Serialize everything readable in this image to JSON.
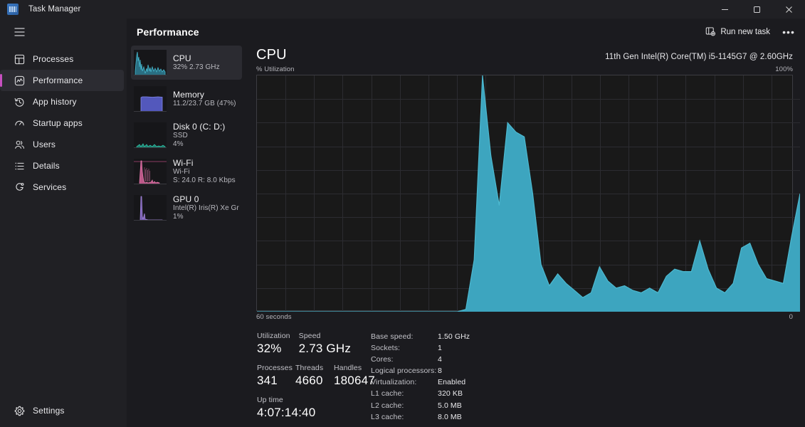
{
  "window": {
    "title": "Task Manager",
    "app_icon": "task-manager-icon",
    "minimize": "minimize-icon",
    "maximize": "maximize-icon",
    "close": "close-icon"
  },
  "sidebar": {
    "hamburger_label": "hamburger-icon",
    "items": [
      {
        "label": "Processes",
        "icon": "processes-icon",
        "selected": false
      },
      {
        "label": "Performance",
        "icon": "performance-icon",
        "selected": true
      },
      {
        "label": "App history",
        "icon": "history-icon",
        "selected": false
      },
      {
        "label": "Startup apps",
        "icon": "startup-icon",
        "selected": false
      },
      {
        "label": "Users",
        "icon": "users-icon",
        "selected": false
      },
      {
        "label": "Details",
        "icon": "details-icon",
        "selected": false
      },
      {
        "label": "Services",
        "icon": "services-icon",
        "selected": false
      }
    ],
    "settings": {
      "label": "Settings",
      "icon": "gear-icon"
    }
  },
  "toolbar": {
    "page_title": "Performance",
    "run_new_task": "Run new task",
    "run_new_task_icon": "new-task-icon",
    "more_label": "•••"
  },
  "devices": [
    {
      "name": "CPU",
      "line1": "32% 2.73 GHz",
      "line2": "",
      "selected": true,
      "color": "#3aa6bf"
    },
    {
      "name": "Memory",
      "line1": "11.2/23.7 GB (47%)",
      "line2": "",
      "selected": false,
      "color": "#6b6fd4"
    },
    {
      "name": "Disk 0 (C: D:)",
      "line1": "SSD",
      "line2": "4%",
      "selected": false,
      "color": "#2bb49a"
    },
    {
      "name": "Wi-Fi",
      "line1": "Wi-Fi",
      "line2": "S: 24.0 R: 8.0 Kbps",
      "selected": false,
      "color": "#d86ba6"
    },
    {
      "name": "GPU 0",
      "line1": "Intel(R) Iris(R) Xe Gra…",
      "line2": "1%",
      "selected": false,
      "color": "#9b78d8"
    }
  ],
  "graph": {
    "title": "CPU",
    "cpu_name": "11th Gen Intel(R) Core(TM) i5-1145G7 @ 2.60GHz",
    "y_axis_label": "% Utilization",
    "y_max_label": "100%",
    "x_left_label": "60 seconds",
    "x_right_label": "0"
  },
  "chart_data": {
    "type": "area",
    "title": "CPU % Utilization over 60 seconds",
    "xlabel": "60 seconds",
    "ylabel": "% Utilization",
    "ylim": [
      0,
      100
    ],
    "xlim": [
      0,
      60
    ],
    "grid": true,
    "legend": null,
    "series_color": "#3da5bf",
    "line_color": "#4cb9d0",
    "x": [
      0,
      1,
      2,
      3,
      4,
      5,
      6,
      7,
      8,
      9,
      10,
      11,
      12,
      13,
      14,
      15,
      16,
      17,
      18,
      19,
      20,
      21,
      22,
      23,
      24,
      25,
      26,
      27,
      28,
      29,
      30,
      31,
      32,
      33,
      34,
      35,
      36,
      37,
      38,
      39,
      40,
      41,
      42,
      43,
      44,
      45,
      46,
      47,
      48,
      49,
      50,
      51,
      52,
      53,
      54,
      55,
      56,
      57,
      58,
      59,
      60
    ],
    "values": [
      0,
      0,
      0,
      0,
      0,
      0,
      0,
      0,
      0,
      0,
      0,
      0,
      0,
      0,
      0,
      0,
      0,
      0,
      0,
      0,
      0,
      0,
      0,
      0,
      0,
      1,
      22,
      100,
      66,
      45,
      80,
      76,
      74,
      50,
      20,
      11,
      16,
      12,
      9,
      6,
      8,
      19,
      13,
      10,
      11,
      9,
      8,
      10,
      8,
      15,
      18,
      17,
      17,
      30,
      18,
      10,
      8,
      12,
      27,
      29,
      20,
      14,
      13,
      12,
      32,
      50
    ],
    "note": "Idle for first 25 intervals, spike to 100% then sustained activity tapering down with periodic bumps; final value rising to ~50%"
  },
  "stats": {
    "left": [
      [
        {
          "label": "Utilization",
          "value": "32%"
        },
        {
          "label": "Speed",
          "value": "2.73 GHz"
        }
      ],
      [
        {
          "label": "Processes",
          "value": "341"
        },
        {
          "label": "Threads",
          "value": "4660"
        },
        {
          "label": "Handles",
          "value": "180647"
        }
      ],
      [
        {
          "label": "Up time",
          "value": "4:07:14:40"
        }
      ]
    ],
    "right": [
      {
        "key": "Base speed:",
        "value": "1.50 GHz"
      },
      {
        "key": "Sockets:",
        "value": "1"
      },
      {
        "key": "Cores:",
        "value": "4"
      },
      {
        "key": "Logical processors:",
        "value": "8"
      },
      {
        "key": "Virtualization:",
        "value": "Enabled"
      },
      {
        "key": "L1 cache:",
        "value": "320 KB"
      },
      {
        "key": "L2 cache:",
        "value": "5.0 MB"
      },
      {
        "key": "L3 cache:",
        "value": "8.0 MB"
      }
    ]
  },
  "colors": {
    "accent_selection": "#c750c0",
    "cpu_graph": "#3da5bf",
    "window_bg": "#1b1b1f",
    "nav_bg": "#202024"
  }
}
